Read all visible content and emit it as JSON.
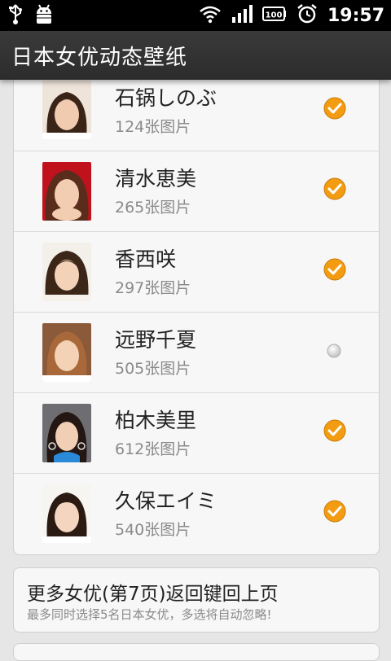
{
  "status_bar": {
    "time": "19:57",
    "battery": "100",
    "left_icons": [
      "usb-icon",
      "android-debug-icon"
    ],
    "right_icons": [
      "wifi-icon",
      "signal-icon",
      "battery-icon",
      "alarm-icon"
    ]
  },
  "app": {
    "title": "日本女优动态壁纸"
  },
  "list": {
    "items": [
      {
        "name": "石锅しのぶ",
        "count": "124张图片",
        "checked": true
      },
      {
        "name": "清水恵美",
        "count": "265张图片",
        "checked": true
      },
      {
        "name": "香西咲",
        "count": "297张图片",
        "checked": true
      },
      {
        "name": "远野千夏",
        "count": "505张图片",
        "checked": false
      },
      {
        "name": "柏木美里",
        "count": "612张图片",
        "checked": true
      },
      {
        "name": "久保エイミ",
        "count": "540张图片",
        "checked": true
      }
    ]
  },
  "footer": {
    "title": "更多女优(第7页)返回键回上页",
    "subtitle": "最多同时选择5名日本女优，多选将自动忽略!"
  },
  "colors": {
    "check_orange": "#f39c12",
    "title_bar": "#333333",
    "background": "#e6e6e6"
  }
}
